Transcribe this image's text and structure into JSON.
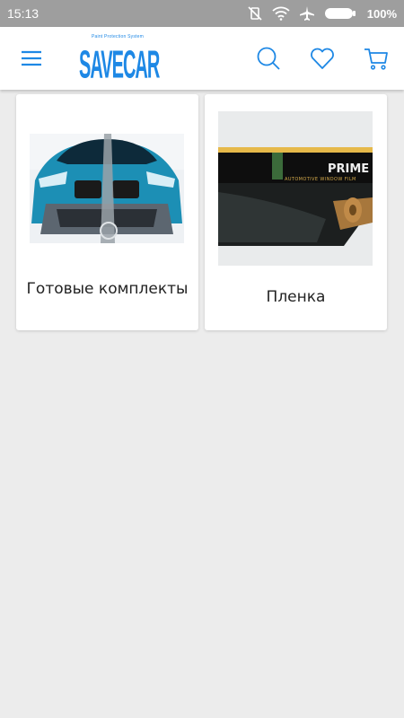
{
  "status": {
    "time": "15:13",
    "battery": "100%",
    "icons": [
      "rotation-off-icon",
      "wifi-icon",
      "airplane-icon",
      "battery-icon"
    ]
  },
  "header": {
    "logo_text": "SAVECAR",
    "logo_tagline": "Paint Protection System",
    "icons": [
      "menu-icon",
      "search-icon",
      "heart-icon",
      "cart-icon"
    ],
    "accent": "#1e88e5"
  },
  "categories": [
    {
      "label": "Готовые комплекты",
      "image": "blue-car-photo"
    },
    {
      "label": "Пленка",
      "image": "window-film-roll-photo"
    }
  ],
  "colors": {
    "background": "#ececec",
    "statusbar": "#9e9e9e",
    "accent": "#1e88e5"
  }
}
